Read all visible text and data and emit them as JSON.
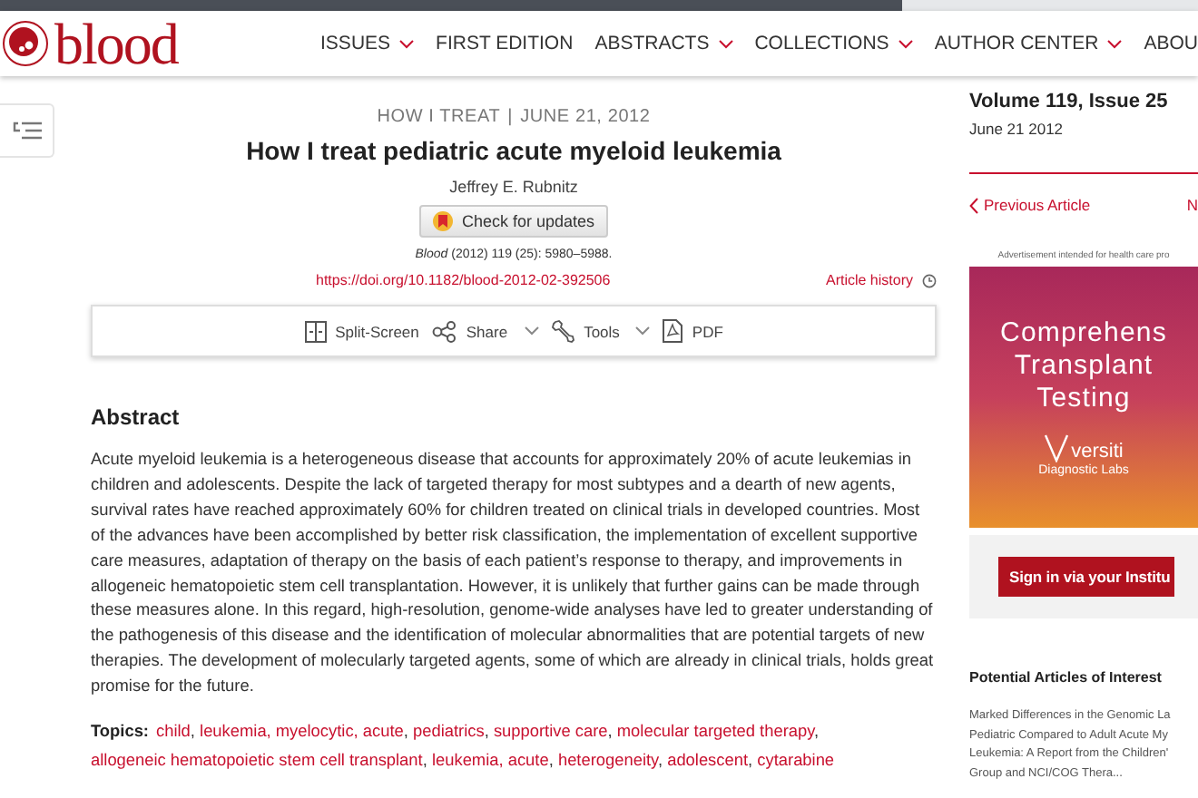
{
  "header": {
    "logo": "blood",
    "nav": [
      {
        "label": "ISSUES",
        "dropdown": true
      },
      {
        "label": "FIRST EDITION",
        "dropdown": false
      },
      {
        "label": "ABSTRACTS",
        "dropdown": true
      },
      {
        "label": "COLLECTIONS",
        "dropdown": true
      },
      {
        "label": "AUTHOR CENTER",
        "dropdown": true
      },
      {
        "label": "ABOU",
        "dropdown": false
      }
    ]
  },
  "article": {
    "category": "HOW I TREAT",
    "separator": "|",
    "date": "JUNE 21, 2012",
    "title": "How I treat pediatric acute myeloid leukemia",
    "author": "Jeffrey E. Rubnitz",
    "check_updates": "Check for updates",
    "citation": "*Blood* (2012) 119 (25): 5980–5988.",
    "doi": "https://doi.org/10.1182/blood-2012-02-392506",
    "history": "Article history"
  },
  "toolbar": [
    {
      "label": "Split-Screen",
      "kind": "split",
      "dropdown": false
    },
    {
      "label": "Share",
      "kind": "share",
      "dropdown": true
    },
    {
      "label": "Tools",
      "kind": "tools",
      "dropdown": true
    },
    {
      "label": "PDF",
      "kind": "pdf",
      "dropdown": false
    }
  ],
  "abstract": {
    "heading": "Abstract",
    "text": "Acute myeloid leukemia is a heterogeneous disease that accounts for approximately 20% of acute leukemias in children and adolescents. Despite the lack of targeted therapy for most subtypes and a dearth of new agents, survival rates have reached approximately 60% for children treated on clinical trials in developed countries. Most of the advances have been accomplished by better risk classification, the implementation of excellent supportive care measures, adaptation of therapy on the basis of each patient’s response to therapy, and improvements in allogeneic hematopoietic stem cell transplantation. However, it is unlikely that further gains can be made through these measures alone. In this regard, high-resolution, genome-wide analyses have led to greater understanding of the pathogenesis of this disease and the identification of molecular abnormalities that are potential targets of new therapies. The development of molecularly targeted agents, some of which are already in clinical trials, holds great promise for the future."
  },
  "topics": {
    "label": "Topics:",
    "separator": ",",
    "items": [
      "child",
      "leukemia, myelocytic, acute",
      "pediatrics",
      "supportive care",
      "molecular targeted therapy",
      "allogeneic hematopoietic stem cell transplant",
      "leukemia, acute",
      "heterogeneity",
      "adolescent",
      "cytarabine"
    ]
  },
  "sidebar": {
    "volume": "Volume 119, Issue 25",
    "date": "June 21 2012",
    "previous": "Previous Article",
    "next": "N",
    "ad_notice": "Advertisement intended for health care pro",
    "ad_lines": [
      "Comprehens",
      "Transplant",
      "Testing"
    ],
    "ad_brand": "versiti",
    "ad_sub": "Diagnostic Labs",
    "sign_in": "Sign in via your Institu",
    "related_heading": "Potential Articles of Interest",
    "related_lines": [
      "Marked Differences in the Genomic La",
      "Pediatric Compared to Adult Acute My",
      "Leukemia: A Report from the Children'",
      "Group and NCI/COG Thera..."
    ]
  }
}
